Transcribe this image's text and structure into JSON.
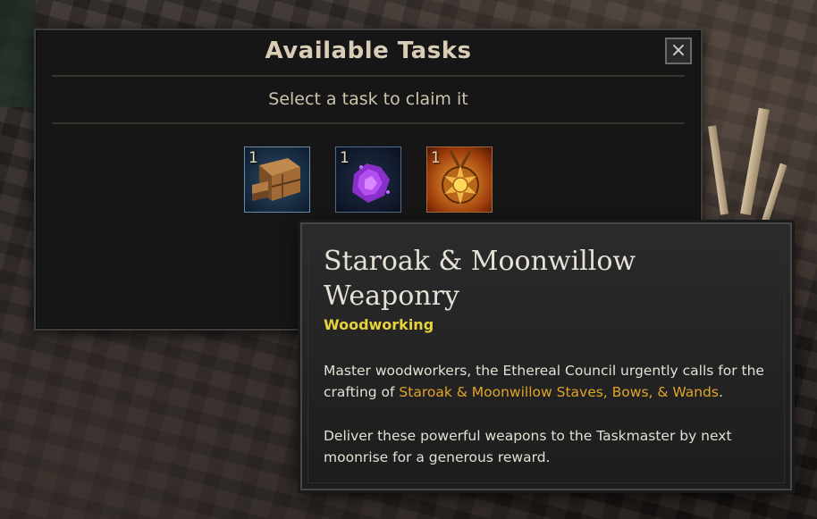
{
  "panel": {
    "title": "Available Tasks",
    "close_icon": "×",
    "subtitle": "Select a task to claim it"
  },
  "task_slots": [
    {
      "count": "1",
      "icon": "wood-planks-icon"
    },
    {
      "count": "1",
      "icon": "purple-crystal-icon"
    },
    {
      "count": "1",
      "icon": "sun-amulet-icon"
    }
  ],
  "tooltip": {
    "title": "Staroak & Moonwillow Weaponry",
    "category": "Woodworking",
    "para1_start": "Master woodworkers, the Ethereal Council urgently calls for the crafting of ",
    "para1_highlight": "Staroak & Moonwillow Staves, Bows, & Wands",
    "para1_end": ".",
    "para2": "Deliver these powerful weapons to the Taskmaster by next moonrise for a generous reward."
  },
  "colors": {
    "category": "#e6d23c",
    "highlight": "#e0a528",
    "title": "#d9cdb8"
  }
}
